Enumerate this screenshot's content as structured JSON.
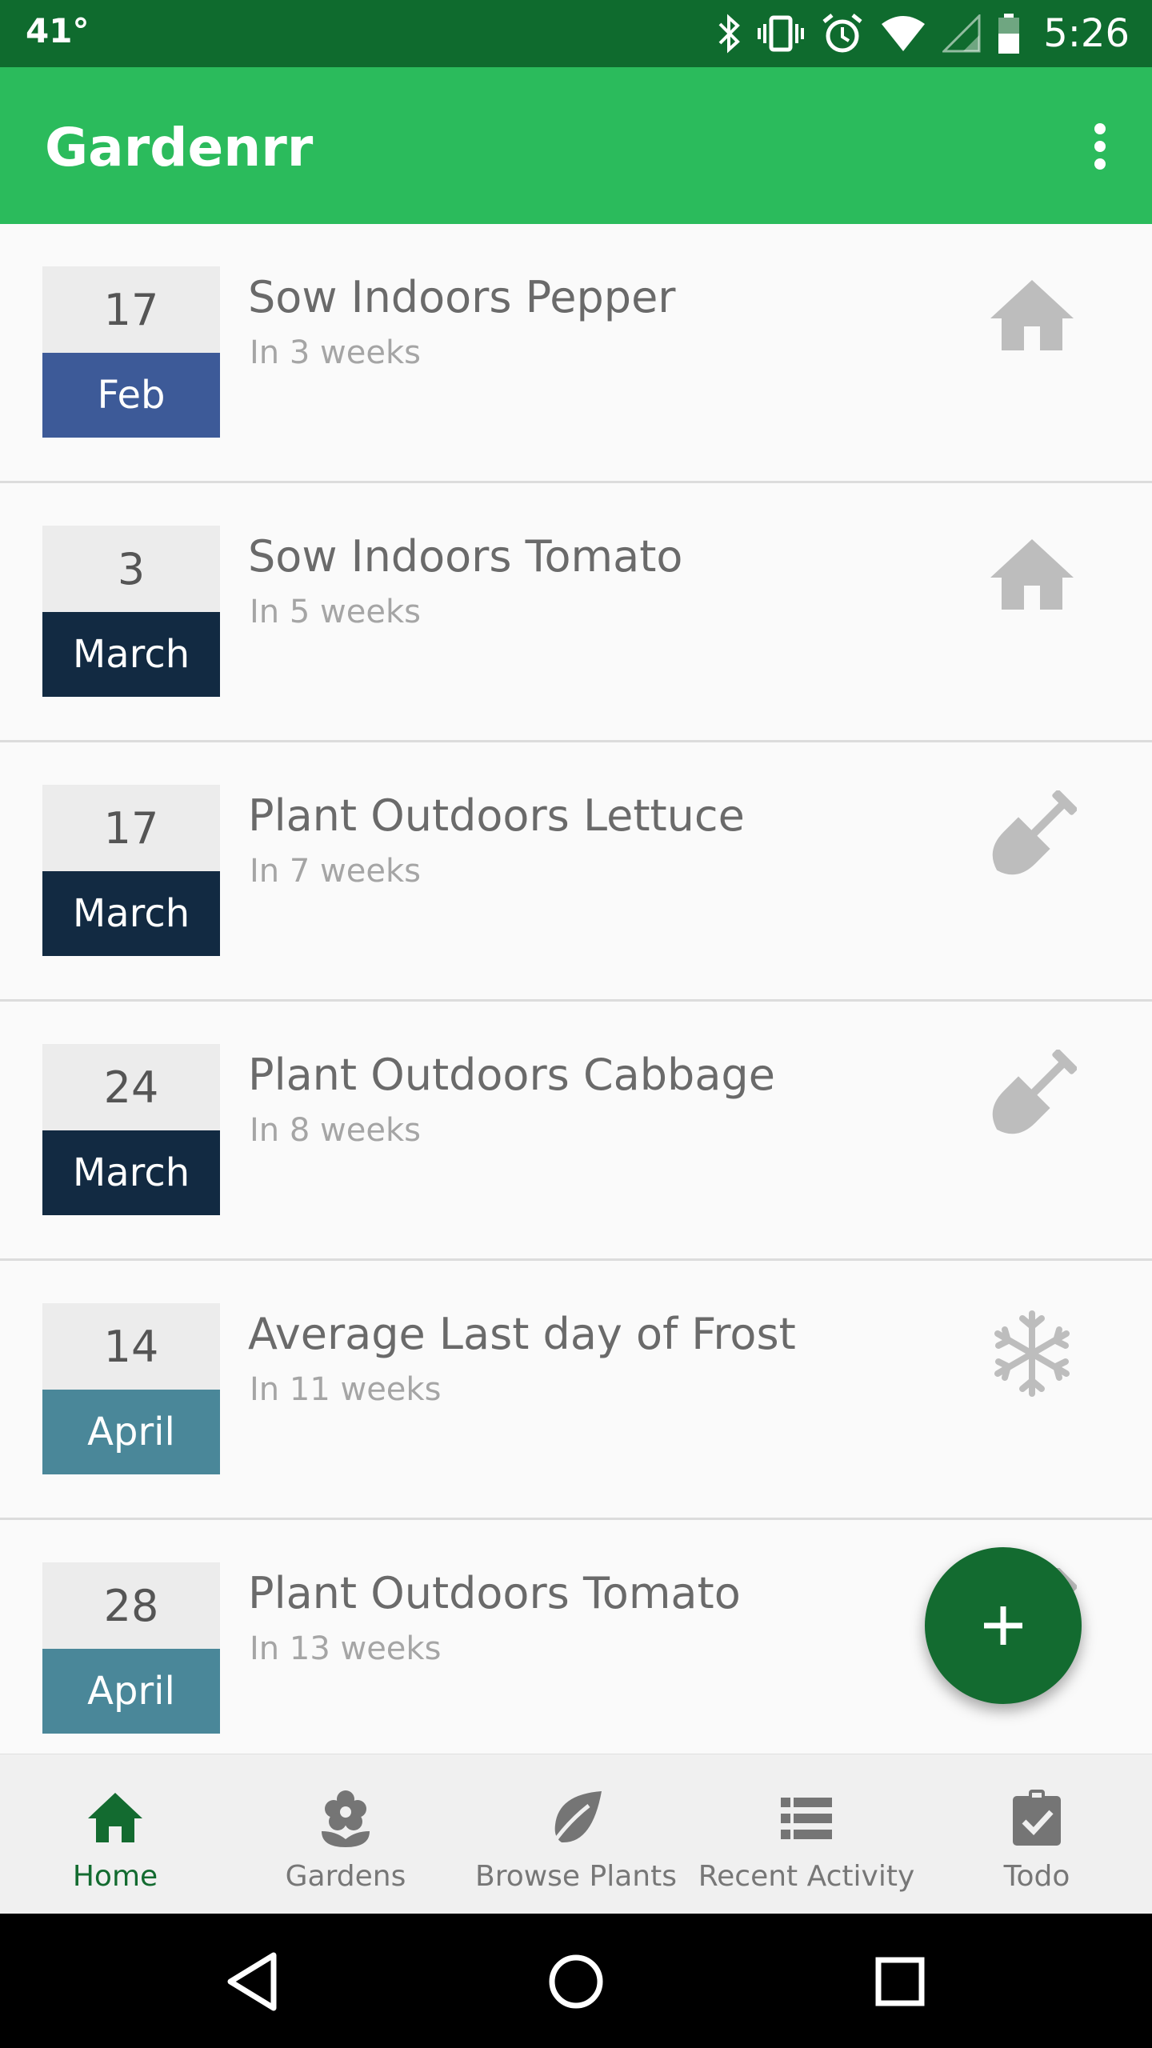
{
  "status_bar": {
    "temperature": "41°",
    "time": "5:26",
    "icons": [
      "bluetooth-icon",
      "vibrate-icon",
      "alarm-icon",
      "wifi-icon",
      "signal-icon",
      "battery-icon"
    ]
  },
  "app_bar": {
    "title": "Gardenrr",
    "menu_icon": "more-vert-icon"
  },
  "events": [
    {
      "day": "17",
      "month": "Feb",
      "month_color": "#3d5a98",
      "title": "Sow Indoors Pepper",
      "subtitle": "In 3 weeks",
      "icon": "house-icon"
    },
    {
      "day": "3",
      "month": "March",
      "month_color": "#122a42",
      "title": "Sow Indoors Tomato",
      "subtitle": "In 5 weeks",
      "icon": "house-icon"
    },
    {
      "day": "17",
      "month": "March",
      "month_color": "#122a42",
      "title": "Plant Outdoors Lettuce",
      "subtitle": "In 7 weeks",
      "icon": "shovel-icon"
    },
    {
      "day": "24",
      "month": "March",
      "month_color": "#122a42",
      "title": "Plant Outdoors Cabbage",
      "subtitle": "In 8 weeks",
      "icon": "shovel-icon"
    },
    {
      "day": "14",
      "month": "April",
      "month_color": "#4a8799",
      "title": "Average Last day of Frost",
      "subtitle": "In 11 weeks",
      "icon": "snowflake-icon"
    },
    {
      "day": "28",
      "month": "April",
      "month_color": "#4a8799",
      "title": "Plant Outdoors Tomato",
      "subtitle": "In 13 weeks",
      "icon": "shovel-icon"
    }
  ],
  "fab": {
    "icon": "plus-icon"
  },
  "bottom_nav": [
    {
      "label": "Home",
      "icon": "home-icon",
      "active": true
    },
    {
      "label": "Gardens",
      "icon": "flower-icon",
      "active": false
    },
    {
      "label": "Browse Plants",
      "icon": "leaf-icon",
      "active": false
    },
    {
      "label": "Recent Activity",
      "icon": "list-icon",
      "active": false
    },
    {
      "label": "Todo",
      "icon": "clipboard-check-icon",
      "active": false
    }
  ],
  "colors": {
    "status_bar": "#0f6b2e",
    "app_bar": "#2bbb5c",
    "accent": "#136b30"
  }
}
